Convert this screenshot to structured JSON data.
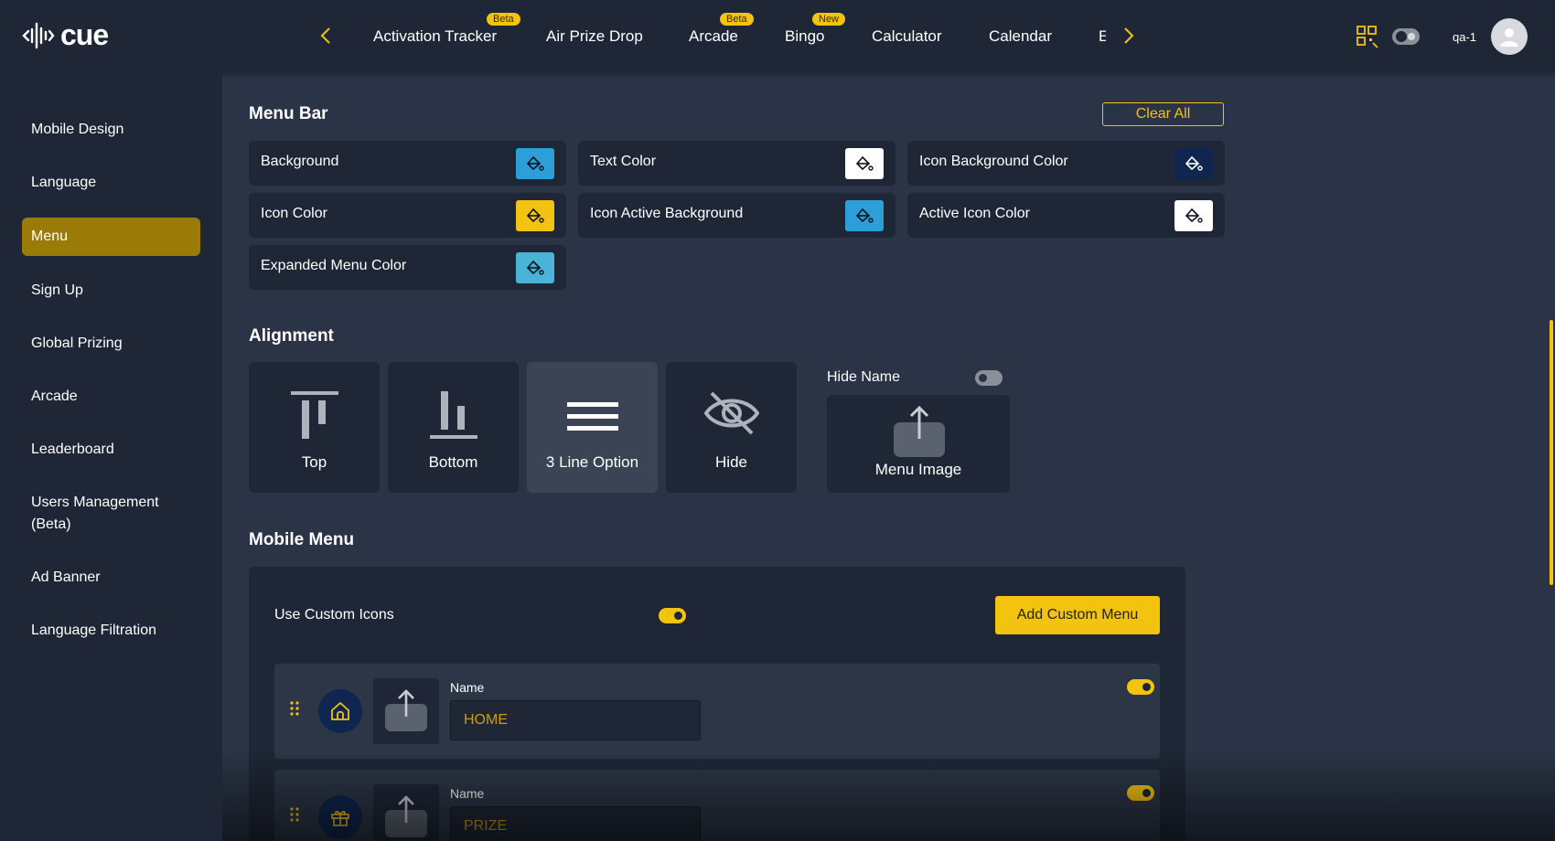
{
  "app": {
    "logo_text": "cue",
    "user": "qa-1"
  },
  "nav": {
    "tabs": [
      {
        "label": "Activation Tracker",
        "badge": "Beta"
      },
      {
        "label": "Air Prize Drop",
        "badge": ""
      },
      {
        "label": "Arcade",
        "badge": "Beta"
      },
      {
        "label": "Bingo",
        "badge": "New"
      },
      {
        "label": "Calculator",
        "badge": ""
      },
      {
        "label": "Calendar",
        "badge": ""
      },
      {
        "label": "E",
        "badge": ""
      }
    ]
  },
  "sidebar": {
    "items": [
      {
        "label": "Mobile Design"
      },
      {
        "label": "Language"
      },
      {
        "label": "Menu",
        "active": true
      },
      {
        "label": "Sign Up"
      },
      {
        "label": "Global Prizing"
      },
      {
        "label": "Arcade"
      },
      {
        "label": "Leaderboard"
      },
      {
        "label": "Users Management (Beta)"
      },
      {
        "label": "Ad Banner"
      },
      {
        "label": "Language Filtration"
      }
    ]
  },
  "menu_bar": {
    "title": "Menu Bar",
    "clear_all": "Clear All",
    "colors": [
      {
        "label": "Background",
        "color": "#2d9fd8"
      },
      {
        "label": "Text Color",
        "color": "#ffffff"
      },
      {
        "label": "Icon Background Color",
        "color": "#0f2650"
      },
      {
        "label": "Icon Color",
        "color": "#f2c30f"
      },
      {
        "label": "Icon Active Background",
        "color": "#2d9fd8"
      },
      {
        "label": "Active Icon Color",
        "color": "#ffffff"
      },
      {
        "label": "Expanded Menu Color",
        "color": "#4bb3d6"
      }
    ]
  },
  "alignment": {
    "title": "Alignment",
    "options": [
      {
        "label": "Top",
        "icon": "align-top-icon"
      },
      {
        "label": "Bottom",
        "icon": "align-bottom-icon"
      },
      {
        "label": "3 Line Option",
        "icon": "hamburger-icon",
        "selected": true
      },
      {
        "label": "Hide",
        "icon": "eye-off-icon"
      }
    ],
    "hide_name_label": "Hide Name",
    "hide_name_on": false,
    "menu_image_label": "Menu Image"
  },
  "mobile_menu": {
    "title": "Mobile Menu",
    "use_custom_icons_label": "Use Custom Icons",
    "use_custom_icons_on": true,
    "add_custom_menu": "Add Custom Menu",
    "items": [
      {
        "name_label": "Name",
        "value": "HOME",
        "icon": "home-icon",
        "enabled": true
      },
      {
        "name_label": "Name",
        "value": "PRIZE",
        "icon": "gift-icon",
        "enabled": true
      }
    ]
  }
}
